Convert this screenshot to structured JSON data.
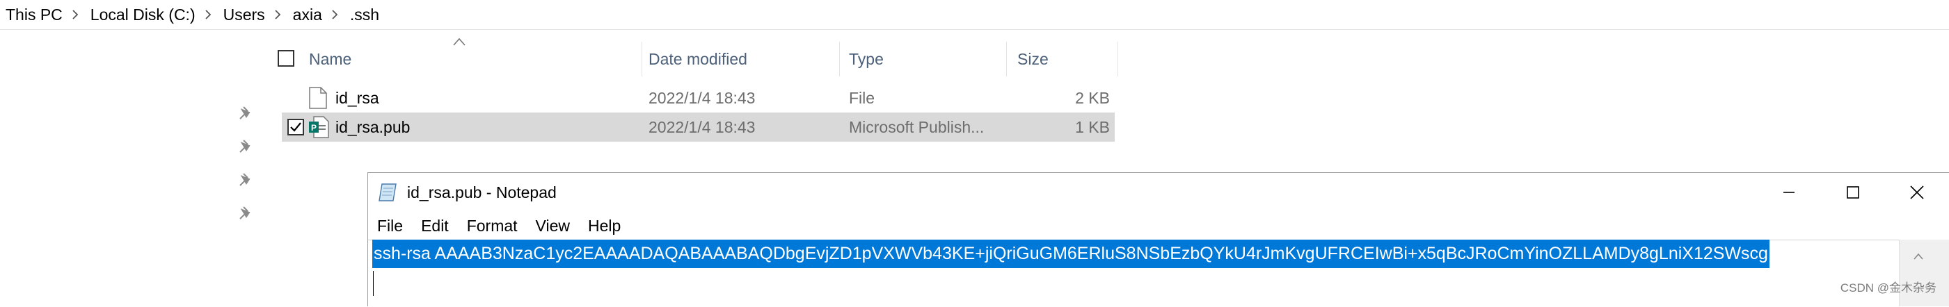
{
  "breadcrumb": {
    "items": [
      "This PC",
      "Local Disk (C:)",
      "Users",
      "axia",
      ".ssh"
    ]
  },
  "columns": {
    "name": "Name",
    "date": "Date modified",
    "type": "Type",
    "size": "Size"
  },
  "files": [
    {
      "name": "id_rsa",
      "date": "2022/1/4 18:43",
      "type": "File",
      "size": "2 KB",
      "icon": "blank-file-icon",
      "selected": false
    },
    {
      "name": "id_rsa.pub",
      "date": "2022/1/4 18:43",
      "type": "Microsoft Publish...",
      "size": "1 KB",
      "icon": "publisher-file-icon",
      "selected": true
    }
  ],
  "notepad": {
    "title": "id_rsa.pub - Notepad",
    "menu": [
      "File",
      "Edit",
      "Format",
      "View",
      "Help"
    ],
    "content": "ssh-rsa AAAAB3NzaC1yc2EAAAADAQABAAABAQDbgEvjZD1pVXWVb43KE+jiQriGuGM6ERluS8NSbEzbQYkU4rJmKvgUFRCEIwBi+x5qBcJRoCmYinOZLLAMDy8gLniX12SWscg"
  },
  "watermark": "CSDN @金木杂务",
  "colors": {
    "selection_blue": "#0078d7",
    "selected_row": "#d9d9d9",
    "header_text": "#4c607a"
  }
}
